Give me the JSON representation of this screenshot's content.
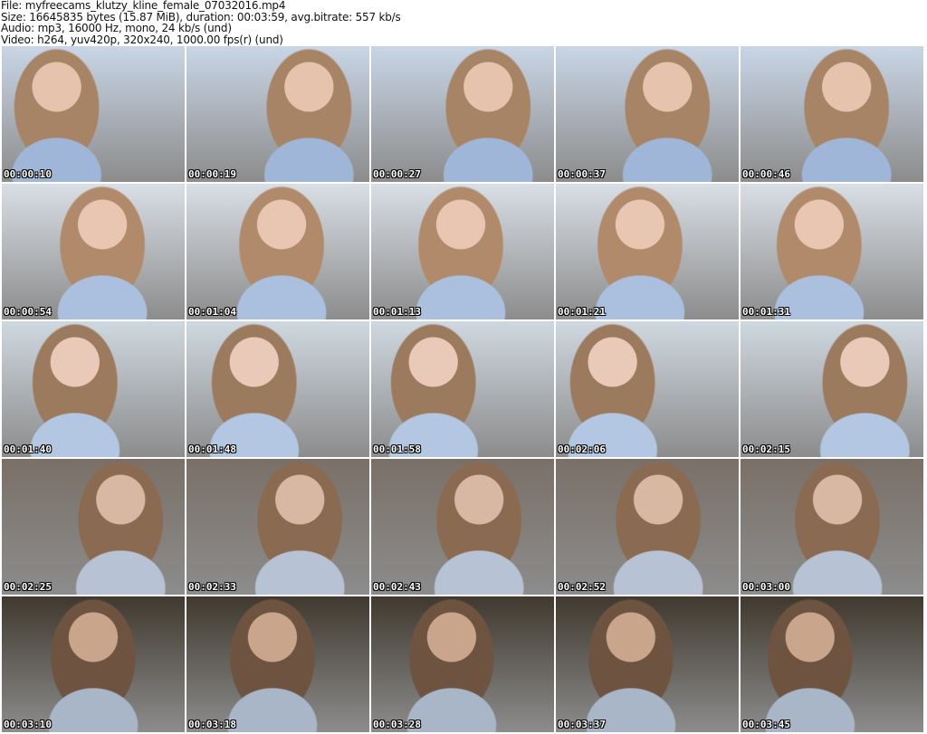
{
  "header": {
    "file": "File: myfreecams_klutzy_kline_female_07032016.mp4",
    "size": "Size: 16645835 bytes (15.87 MiB), duration: 00:03:59, avg.bitrate: 557 kb/s",
    "audio": "Audio: mp3, 16000 Hz, mono, 24 kb/s (und)",
    "video": "Video: h264, yuv420p, 320x240, 1000.00 fps(r) (und)"
  },
  "thumbnails": [
    {
      "time": "00:00:10"
    },
    {
      "time": "00:00:19"
    },
    {
      "time": "00:00:27"
    },
    {
      "time": "00:00:37"
    },
    {
      "time": "00:00:46"
    },
    {
      "time": "00:00:54"
    },
    {
      "time": "00:01:04"
    },
    {
      "time": "00:01:13"
    },
    {
      "time": "00:01:21"
    },
    {
      "time": "00:01:31"
    },
    {
      "time": "00:01:40"
    },
    {
      "time": "00:01:48"
    },
    {
      "time": "00:01:58"
    },
    {
      "time": "00:02:06"
    },
    {
      "time": "00:02:15"
    },
    {
      "time": "00:02:25"
    },
    {
      "time": "00:02:33"
    },
    {
      "time": "00:02:43"
    },
    {
      "time": "00:02:52"
    },
    {
      "time": "00:03:00"
    },
    {
      "time": "00:03:10"
    },
    {
      "time": "00:03:18"
    },
    {
      "time": "00:03:28"
    },
    {
      "time": "00:03:37"
    },
    {
      "time": "00:03:45"
    }
  ]
}
